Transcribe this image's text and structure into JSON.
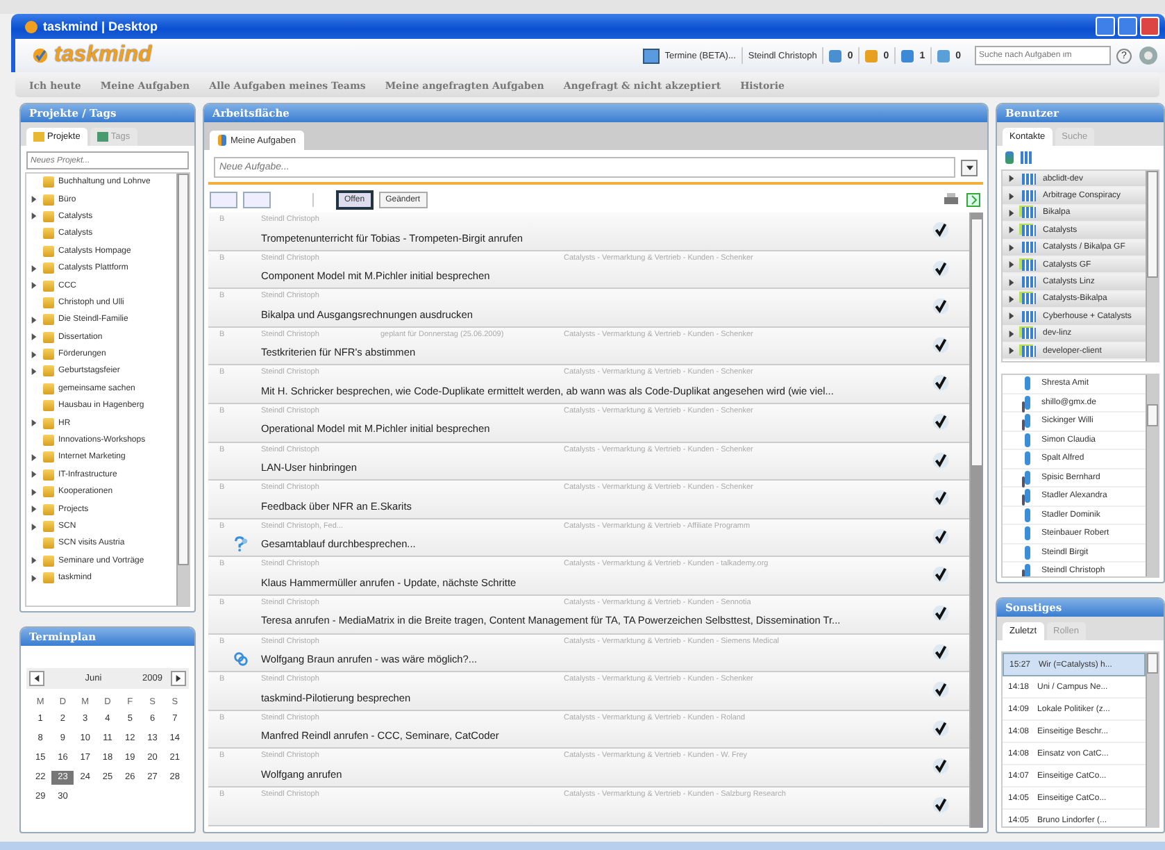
{
  "window": {
    "title": "taskmind | Desktop"
  },
  "header": {
    "logo": "taskmind",
    "calendar_link": "Termine (BETA)...",
    "user": "Steindl Christoph",
    "counters": [
      {
        "kind": "inbox",
        "value": "0"
      },
      {
        "kind": "star",
        "value": "0"
      },
      {
        "kind": "question",
        "value": "1"
      },
      {
        "kind": "tool",
        "value": "0"
      }
    ],
    "search": {
      "placeholder": "Suche nach Aufgaben im"
    },
    "help": "?"
  },
  "nav": [
    {
      "label": "Ich heute"
    },
    {
      "label": "Meine Aufgaben"
    },
    {
      "label": "Alle Aufgaben meines Teams"
    },
    {
      "label": "Meine angefragten Aufgaben"
    },
    {
      "label": "Angefragt & nicht akzeptiert"
    },
    {
      "label": "Historie"
    }
  ],
  "projects": {
    "title": "Projekte / Tags",
    "tabs": [
      {
        "label": "Projekte",
        "selected": true
      },
      {
        "label": "Tags",
        "selected": false
      }
    ],
    "search": {
      "placeholder": "Neues Projekt..."
    },
    "items": [
      {
        "label": "Buchhaltung und Lohnve",
        "expandable": false
      },
      {
        "label": "Büro",
        "expandable": true
      },
      {
        "label": "Catalysts",
        "expandable": true
      },
      {
        "label": "Catalysts",
        "expandable": false
      },
      {
        "label": "Catalysts Hompage",
        "expandable": false
      },
      {
        "label": "Catalysts Plattform",
        "expandable": true
      },
      {
        "label": "CCC",
        "expandable": true
      },
      {
        "label": "Christoph und Ulli",
        "expandable": false
      },
      {
        "label": "Die Steindl-Familie",
        "expandable": true
      },
      {
        "label": "Dissertation",
        "expandable": true
      },
      {
        "label": "Förderungen",
        "expandable": true
      },
      {
        "label": "Geburtstagsfeier",
        "expandable": true
      },
      {
        "label": "gemeinsame sachen",
        "expandable": false
      },
      {
        "label": "Hausbau in Hagenberg",
        "expandable": false
      },
      {
        "label": "HR",
        "expandable": true
      },
      {
        "label": "Innovations-Workshops",
        "expandable": false
      },
      {
        "label": "Internet Marketing",
        "expandable": true
      },
      {
        "label": "IT-Infrastructure",
        "expandable": true
      },
      {
        "label": "Kooperationen",
        "expandable": true
      },
      {
        "label": "Projects",
        "expandable": true
      },
      {
        "label": "SCN",
        "expandable": true
      },
      {
        "label": "SCN visits Austria",
        "expandable": false
      },
      {
        "label": "Seminare und Vorträge",
        "expandable": true
      },
      {
        "label": "taskmind",
        "expandable": true
      }
    ]
  },
  "calendar": {
    "title": "Terminplan",
    "month": "Juni",
    "year": "2009",
    "weekdays": [
      "M",
      "D",
      "M",
      "D",
      "F",
      "S",
      "S"
    ],
    "weeks": [
      [
        {
          "day": "1",
          "selected": false
        },
        {
          "day": "2",
          "selected": false
        },
        {
          "day": "3",
          "selected": false
        },
        {
          "day": "4",
          "selected": false
        },
        {
          "day": "5",
          "selected": false
        },
        {
          "day": "6",
          "selected": false
        },
        {
          "day": "7",
          "selected": false
        }
      ],
      [
        {
          "day": "8",
          "selected": false
        },
        {
          "day": "9",
          "selected": false
        },
        {
          "day": "10",
          "selected": false
        },
        {
          "day": "11",
          "selected": false
        },
        {
          "day": "12",
          "selected": false
        },
        {
          "day": "13",
          "selected": false
        },
        {
          "day": "14",
          "selected": false
        }
      ],
      [
        {
          "day": "15",
          "selected": false
        },
        {
          "day": "16",
          "selected": false
        },
        {
          "day": "17",
          "selected": false
        },
        {
          "day": "18",
          "selected": false
        },
        {
          "day": "19",
          "selected": false
        },
        {
          "day": "20",
          "selected": false
        },
        {
          "day": "21",
          "selected": false
        }
      ],
      [
        {
          "day": "22",
          "selected": false
        },
        {
          "day": "23",
          "selected": true
        },
        {
          "day": "24",
          "selected": false
        },
        {
          "day": "25",
          "selected": false
        },
        {
          "day": "26",
          "selected": false
        },
        {
          "day": "27",
          "selected": false
        },
        {
          "day": "28",
          "selected": false
        }
      ],
      [
        {
          "day": "29",
          "selected": false
        },
        {
          "day": "30",
          "selected": false
        }
      ]
    ]
  },
  "workspace": {
    "title": "Arbeitsfläche",
    "tab": "Meine Aufgaben",
    "new_task": {
      "placeholder": "Neue Aufgabe..."
    },
    "filters": [
      {
        "label": "Offen",
        "selected": true
      },
      {
        "label": "Geändert",
        "selected": false
      }
    ],
    "tasks": [
      {
        "priority": "B",
        "owner": "Steindl Christoph",
        "title": "Trompetenunterricht für Tobias - Trompeten-Birgit anrufen"
      },
      {
        "priority": "B",
        "owner": "Steindl Christoph",
        "category": "Catalysts - Vermarktung & Vertrieb - Kunden - Schenker",
        "title": "Component Model mit M.Pichler initial besprechen"
      },
      {
        "priority": "B",
        "owner": "Steindl Christoph",
        "title": "Bikalpa und Ausgangsrechnungen ausdrucken"
      },
      {
        "priority": "B",
        "owner": "Steindl Christoph",
        "planned": "geplant für Donnerstag (25.06.2009)",
        "category": "Catalysts - Vermarktung & Vertrieb - Kunden - Schenker",
        "title": "Testkriterien für NFR's abstimmen"
      },
      {
        "priority": "B",
        "owner": "Steindl Christoph",
        "category": "Catalysts - Vermarktung & Vertrieb - Kunden - Schenker",
        "title": "Mit H. Schricker besprechen, wie Code-Duplikate ermittelt werden, ab wann was als Code-Duplikat angesehen wird (wie viel..."
      },
      {
        "priority": "B",
        "owner": "Steindl Christoph",
        "category": "Catalysts - Vermarktung & Vertrieb - Kunden - Schenker",
        "title": "Operational Model mit M.Pichler initial besprechen"
      },
      {
        "priority": "B",
        "owner": "Steindl Christoph",
        "category": "Catalysts - Vermarktung & Vertrieb - Kunden - Schenker",
        "title": "LAN-User hinbringen"
      },
      {
        "priority": "B",
        "owner": "Steindl Christoph",
        "category": "Catalysts - Vermarktung & Vertrieb - Kunden - Schenker",
        "title": "Feedback über NFR an E.Skarits"
      },
      {
        "priority": "B",
        "owner": "Steindl Christoph, Fed...",
        "category": "Catalysts - Vermarktung & Vertrieb - Affiliate Programm",
        "kind": "question",
        "title": "Gesamtablauf durchbesprechen..."
      },
      {
        "priority": "B",
        "owner": "Steindl Christoph",
        "category": "Catalysts - Vermarktung & Vertrieb - Kunden - talkademy.org",
        "title": "Klaus Hammermüller anrufen - Update, nächste Schritte"
      },
      {
        "priority": "B",
        "owner": "Steindl Christoph",
        "category": "Catalysts - Vermarktung & Vertrieb - Kunden - Sennotia",
        "title": "Teresa anrufen - MediaMatrix in die Breite tragen, Content Management für TA, TA Powerzeichen Selbsttest, Dissemination Tr..."
      },
      {
        "priority": "B",
        "owner": "Steindl Christoph",
        "category": "Catalysts - Vermarktung & Vertrieb - Kunden - Siemens Medical",
        "kind": "link",
        "title": "Wolfgang Braun anrufen - was wäre möglich?..."
      },
      {
        "priority": "B",
        "owner": "Steindl Christoph",
        "category": "Catalysts - Vermarktung & Vertrieb - Kunden - Schenker",
        "title": "taskmind-Pilotierung besprechen"
      },
      {
        "priority": "B",
        "owner": "Steindl Christoph",
        "category": "Catalysts - Vermarktung & Vertrieb - Kunden - Roland",
        "title": "Manfred Reindl anrufen - CCC, Seminare, CatCoder"
      },
      {
        "priority": "B",
        "owner": "Steindl Christoph",
        "category": "Catalysts - Vermarktung & Vertrieb - Kunden - W. Frey",
        "title": "Wolfgang anrufen"
      },
      {
        "priority": "B",
        "owner": "Steindl Christoph",
        "category": "Catalysts - Vermarktung & Vertrieb - Kunden - Salzburg Research"
      }
    ]
  },
  "users": {
    "title": "Benutzer",
    "tabs": [
      {
        "label": "Kontakte",
        "selected": true
      },
      {
        "label": "Suche",
        "selected": false
      }
    ],
    "groups": [
      {
        "label": "abclidt-dev",
        "kind": "team"
      },
      {
        "label": "Arbitrage Conspiracy",
        "kind": "team"
      },
      {
        "label": "Bikalpa",
        "kind": "project"
      },
      {
        "label": "Catalysts",
        "kind": "project"
      },
      {
        "label": "Catalysts / Bikalpa GF",
        "kind": "team"
      },
      {
        "label": "Catalysts GF",
        "kind": "project"
      },
      {
        "label": "Catalysts Linz",
        "kind": "team"
      },
      {
        "label": "Catalysts-Bikalpa",
        "kind": "project"
      },
      {
        "label": "Cyberhouse + Catalysts",
        "kind": "team"
      },
      {
        "label": "dev-linz",
        "kind": "project"
      },
      {
        "label": "developer-client",
        "kind": "project"
      }
    ],
    "people": [
      {
        "name": "Shresta Amit",
        "kind": "user"
      },
      {
        "name": "shillo@gmx.de",
        "kind": "external"
      },
      {
        "name": "Sickinger Willi",
        "kind": "external"
      },
      {
        "name": "Simon Claudia",
        "kind": "user"
      },
      {
        "name": "Spalt Alfred",
        "kind": "user"
      },
      {
        "name": "Spisic Bernhard",
        "kind": "external"
      },
      {
        "name": "Stadler Alexandra",
        "kind": "external"
      },
      {
        "name": "Stadler Dominik",
        "kind": "user"
      },
      {
        "name": "Steinbauer Robert",
        "kind": "user"
      },
      {
        "name": "Steindl Birgit",
        "kind": "user"
      },
      {
        "name": "Steindl Christoph",
        "kind": "external"
      }
    ]
  },
  "misc": {
    "title": "Sonstiges",
    "tabs": [
      {
        "label": "Zuletzt",
        "selected": true
      },
      {
        "label": "Rollen",
        "selected": false
      }
    ],
    "recent": [
      {
        "time": "15:27",
        "label": "Wir (=Catalysts) h...",
        "selected": true
      },
      {
        "time": "14:18",
        "label": "Uni / Campus Ne...",
        "selected": false
      },
      {
        "time": "14:09",
        "label": "Lokale Politiker (z...",
        "selected": false
      },
      {
        "time": "14:08",
        "label": "Einseitige Beschr...",
        "selected": false
      },
      {
        "time": "14:08",
        "label": "Einsatz von CatC...",
        "selected": false
      },
      {
        "time": "14:07",
        "label": "Einseitige CatCo...",
        "selected": false
      },
      {
        "time": "14:05",
        "label": "Einseitige CatCo...",
        "selected": false
      },
      {
        "time": "14:05",
        "label": "Bruno Lindorfer (...",
        "selected": false
      }
    ]
  }
}
